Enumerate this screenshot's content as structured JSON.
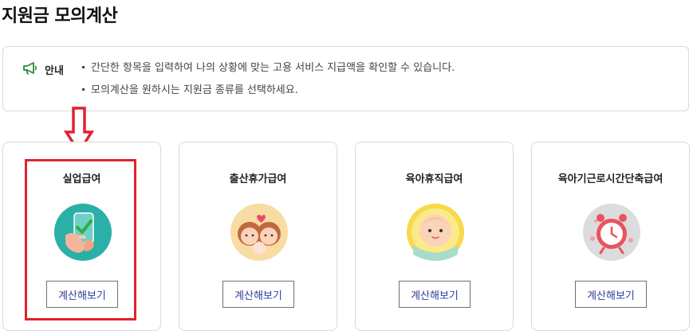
{
  "page": {
    "title": "지원금 모의계산"
  },
  "notice": {
    "label": "안내",
    "icon": "megaphone-icon",
    "lines": [
      "간단한 항목을 입력하여 나의 상황에 맞는 고용 서비스 지급액을 확인할 수 있습니다.",
      "모의계산을 원하시는 지원금 종류를 선택하세요."
    ]
  },
  "cards": [
    {
      "title": "실업급여",
      "button_label": "계산해보기",
      "icon": "phone-check-illustration",
      "selected": true
    },
    {
      "title": "출산휴가급여",
      "button_label": "계산해보기",
      "icon": "parent-baby-illustration",
      "selected": false
    },
    {
      "title": "육아휴직급여",
      "button_label": "계산해보기",
      "icon": "baby-illustration",
      "selected": false
    },
    {
      "title": "육아기근로시간단축급여",
      "button_label": "계산해보기",
      "icon": "alarm-clock-illustration",
      "selected": false
    }
  ],
  "colors": {
    "highlight": "#e0232e",
    "button_text": "#2b3f9a",
    "notice_icon": "#2a8a3a",
    "border": "#d9d9d9"
  }
}
